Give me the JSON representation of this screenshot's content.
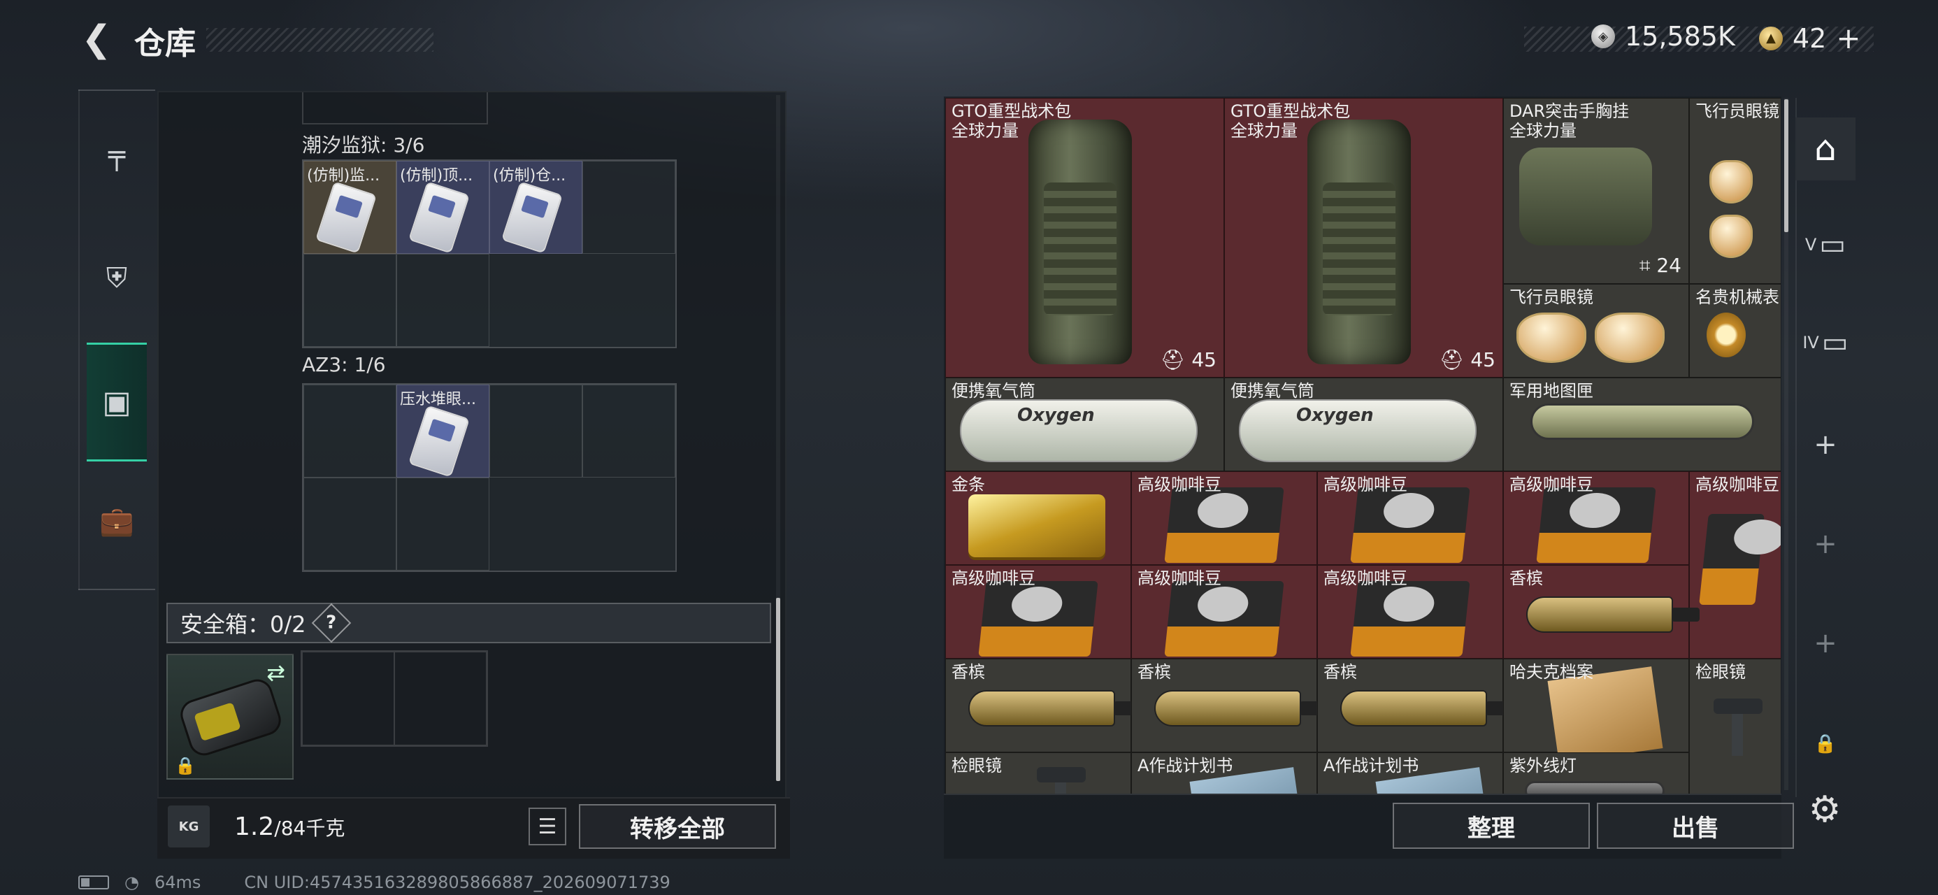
{
  "header": {
    "back_icon": "chevron-left",
    "title": "仓库"
  },
  "currency": [
    {
      "icon": "silver-coin-icon",
      "value": "15,585K"
    },
    {
      "icon": "gold-coin-icon",
      "value": "42",
      "add_symbol": "+"
    }
  ],
  "left_rail": {
    "items": [
      "weapon-icon",
      "armor-icon",
      "backpack-icon",
      "briefcase-icon"
    ],
    "active": "backpack-icon"
  },
  "sections": [
    {
      "label": "潮汐监狱: 3/6",
      "items": [
        "(仿制)监...",
        "(仿制)顶...",
        "(仿制)仓..."
      ]
    },
    {
      "label": "AZ3: 1/6",
      "items": [
        "压水堆眼..."
      ]
    }
  ],
  "safe": {
    "label": "安全箱：0/2",
    "help": "?"
  },
  "weight": {
    "icon_text": "KG",
    "value": "1.2",
    "unit": "/84千克"
  },
  "buttons": {
    "transfer_all": "转移全部",
    "organize": "整理",
    "sell": "出售"
  },
  "inventory": [
    {
      "name": "GTO重型战术包",
      "sub": "全球力量",
      "count": "45",
      "count_icon": "capacity-icon"
    },
    {
      "name": "GTO重型战术包",
      "sub": "全球力量",
      "count": "45",
      "count_icon": "capacity-icon"
    },
    {
      "name": "DAR突击手胸挂",
      "sub": "全球力量",
      "count": "24",
      "count_icon": "capacity-icon"
    },
    {
      "name": "飞行员眼镜"
    },
    {
      "name": "飞行员眼镜"
    },
    {
      "name": "名贵机械表"
    },
    {
      "name": "便携氧气筒",
      "label_text": "Oxygen"
    },
    {
      "name": "便携氧气筒",
      "label_text": "Oxygen"
    },
    {
      "name": "军用地图匣"
    },
    {
      "name": "金条"
    },
    {
      "name": "高级咖啡豆"
    },
    {
      "name": "高级咖啡豆"
    },
    {
      "name": "高级咖啡豆"
    },
    {
      "name": "高级咖啡豆"
    },
    {
      "name": "高级咖啡豆"
    },
    {
      "name": "高级咖啡豆"
    },
    {
      "name": "高级咖啡豆"
    },
    {
      "name": "香槟"
    },
    {
      "name": "香槟"
    },
    {
      "name": "香槟"
    },
    {
      "name": "香槟"
    },
    {
      "name": "哈夫克档案"
    },
    {
      "name": "检眼镜"
    },
    {
      "name": "检眼镜"
    },
    {
      "name": "A作战计划书"
    },
    {
      "name": "A作战计划书"
    },
    {
      "name": "紫外线灯"
    }
  ],
  "right_rail": {
    "items": [
      "storage-icon",
      "V",
      "IV",
      "+",
      "+",
      "+",
      "lock-icon"
    ]
  },
  "status": {
    "ping": "64ms",
    "uid": "CN UID:457435163289805866887_202609071739"
  },
  "colors": {
    "accent": "#35d0a5",
    "rare_red": "#5b2a2f"
  }
}
